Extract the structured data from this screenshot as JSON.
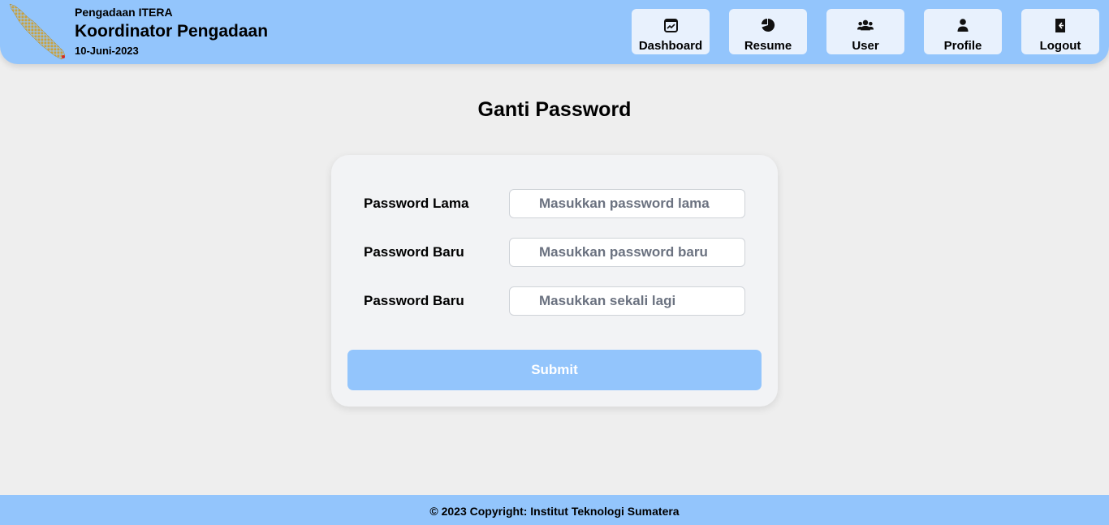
{
  "header": {
    "org": "Pengadaan ITERA",
    "role": "Koordinator Pengadaan",
    "date": "10-Juni-2023",
    "logo_icon": "sumatra-map-logo"
  },
  "nav": [
    {
      "label": "Dashboard",
      "icon": "dashboard-chart-icon"
    },
    {
      "label": "Resume",
      "icon": "pie-chart-icon"
    },
    {
      "label": "User",
      "icon": "users-icon"
    },
    {
      "label": "Profile",
      "icon": "person-icon"
    },
    {
      "label": "Logout",
      "icon": "door-exit-icon"
    }
  ],
  "page": {
    "title": "Ganti Password"
  },
  "form": {
    "fields": [
      {
        "label": "Password Lama",
        "placeholder": "Masukkan password lama",
        "value": ""
      },
      {
        "label": "Password Baru",
        "placeholder": "Masukkan password baru",
        "value": ""
      },
      {
        "label": "Password Baru",
        "placeholder": "Masukkan sekali lagi",
        "value": ""
      }
    ],
    "submit_label": "Submit"
  },
  "footer": {
    "copyright": "© 2023 Copyright: Institut Teknologi Sumatera"
  },
  "colors": {
    "primary": "#93c5fc",
    "nav_button": "#e8f1fd",
    "background": "#eeeeee",
    "card": "#f2f3f5"
  }
}
